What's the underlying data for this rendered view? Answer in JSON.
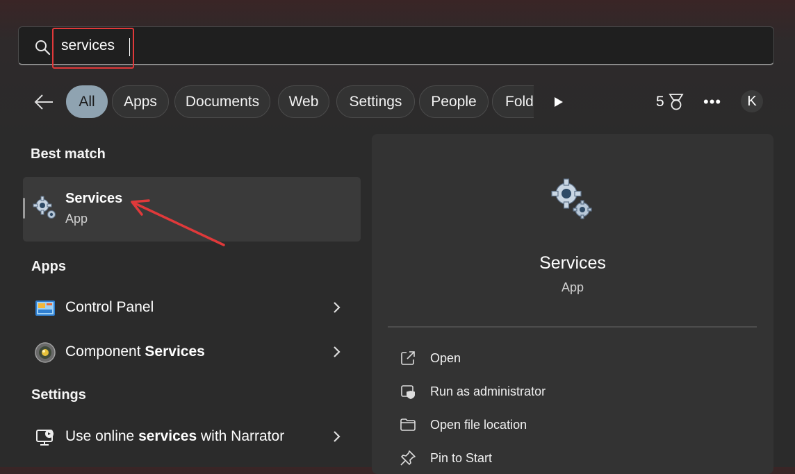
{
  "search": {
    "value": "services",
    "icon": "search-icon"
  },
  "filters": {
    "back_icon": "back-arrow-icon",
    "chips": [
      "All",
      "Apps",
      "Documents",
      "Web",
      "Settings",
      "People",
      "Fold"
    ],
    "active": "All",
    "reward_count": "5",
    "more_icon": "more-icon",
    "avatar_initial": "K"
  },
  "best_match": {
    "title": "Best match",
    "item": {
      "name": "Services",
      "type": "App",
      "icon": "services-gear-icon"
    }
  },
  "apps": {
    "title": "Apps",
    "items": [
      {
        "label": "Control Panel",
        "icon": "control-panel-icon"
      },
      {
        "label_pre": "Component ",
        "label_bold": "Services",
        "icon": "component-services-icon"
      }
    ]
  },
  "settings": {
    "title": "Settings",
    "items": [
      {
        "label_pre": "Use online ",
        "label_bold": "services",
        "label_post": " with Narrator",
        "icon": "narrator-icon"
      }
    ]
  },
  "preview": {
    "name": "Services",
    "type": "App",
    "actions": [
      {
        "label": "Open",
        "icon": "open-external-icon"
      },
      {
        "label": "Run as administrator",
        "icon": "shield-icon"
      },
      {
        "label": "Open file location",
        "icon": "folder-icon"
      },
      {
        "label": "Pin to Start",
        "icon": "pin-icon"
      }
    ]
  },
  "colors": {
    "highlight": "#e0393a",
    "active_chip": "#8fa3b1"
  }
}
